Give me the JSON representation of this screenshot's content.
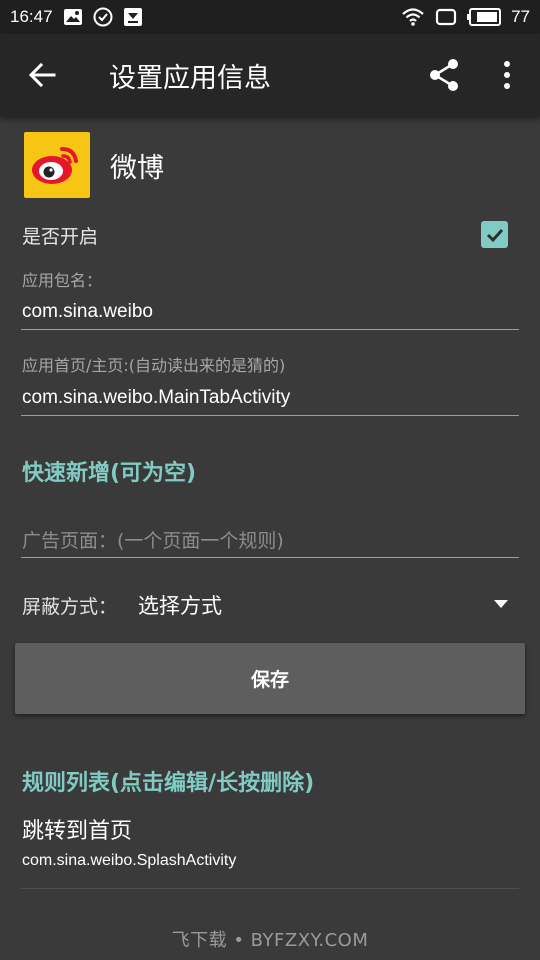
{
  "status_bar": {
    "time": "16:47",
    "battery": "77",
    "icons": [
      "image-notification-icon",
      "check-circle-icon",
      "download-box-icon",
      "wifi-icon",
      "screen-icon",
      "battery-icon"
    ]
  },
  "app_bar": {
    "title": "设置应用信息",
    "icons": [
      "back-arrow-icon",
      "share-icon",
      "more-vert-icon"
    ]
  },
  "app": {
    "name": "微博",
    "logo_icon": "weibo-logo-icon"
  },
  "enable": {
    "label": "是否开启",
    "checked": true
  },
  "package": {
    "label": "应用包名：",
    "value": "com.sina.weibo"
  },
  "home_page": {
    "label": "应用首页/主页:(自动读出来的是猜的)",
    "value": "com.sina.weibo.MainTabActivity"
  },
  "quick_add": {
    "title": "快速新增(可为空)",
    "ad_page_placeholder": "广告页面：(一个页面一个规则)",
    "block_mode_label": "屏蔽方式：",
    "block_mode_value": "选择方式"
  },
  "save_button": "保存",
  "rules": {
    "title": "规则列表(点击编辑/长按删除)",
    "items": [
      {
        "name": "跳转到首页",
        "activity": "com.sina.weibo.SplashActivity"
      }
    ]
  },
  "watermark": "飞下载 • BYFZXY.COM",
  "colors": {
    "accent": "#80cbc4",
    "background": "#3a3a3a",
    "app_bar": "#262626",
    "status_bar": "#1f1f1f",
    "button": "#5e5e5e",
    "logo_bg": "#f7c514"
  }
}
